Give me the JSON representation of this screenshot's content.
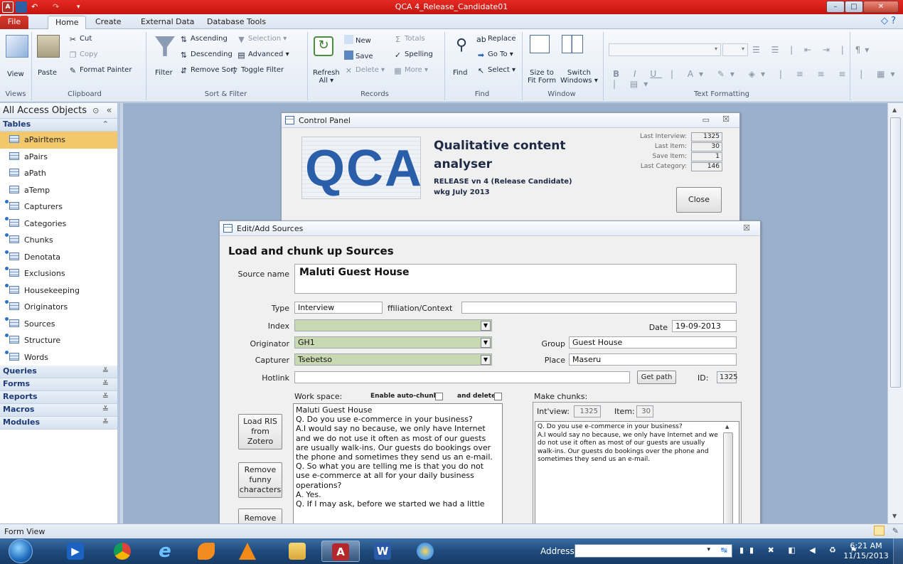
{
  "app": {
    "title": "QCA 4_Release_Candidate01",
    "window_buttons": [
      "–",
      "□",
      "✕"
    ]
  },
  "tabs": [
    "File",
    "Home",
    "Create",
    "External Data",
    "Database Tools"
  ],
  "ribbon": {
    "views": {
      "view": "View",
      "label": "Views"
    },
    "clipboard": {
      "paste": "Paste",
      "cut": "Cut",
      "copy": "Copy",
      "format_painter": "Format Painter",
      "label": "Clipboard"
    },
    "sort_filter": {
      "filter": "Filter",
      "ascending": "Ascending",
      "descending": "Descending",
      "remove_sort": "Remove Sort",
      "selection": "Selection",
      "advanced": "Advanced",
      "toggle_filter": "Toggle Filter",
      "label": "Sort & Filter"
    },
    "records": {
      "refresh": "Refresh",
      "refresh_sub": "All",
      "new": "New",
      "save": "Save",
      "delete": "Delete",
      "totals": "Totals",
      "spelling": "Spelling",
      "more": "More",
      "label": "Records"
    },
    "find": {
      "find": "Find",
      "replace": "Replace",
      "goto": "Go To",
      "select": "Select",
      "label": "Find"
    },
    "window": {
      "size_to_fit": "Size to",
      "size_to_fit2": "Fit Form",
      "switch": "Switch",
      "switch2": "Windows",
      "label": "Window"
    },
    "text_formatting": {
      "label": "Text Formatting"
    }
  },
  "nav": {
    "header": "All Access Objects",
    "tables_label": "Tables",
    "tables": [
      {
        "name": "aPairItems",
        "linked": false
      },
      {
        "name": "aPairs",
        "linked": false
      },
      {
        "name": "aPath",
        "linked": false
      },
      {
        "name": "aTemp",
        "linked": false
      },
      {
        "name": "Capturers",
        "linked": true
      },
      {
        "name": "Categories",
        "linked": true
      },
      {
        "name": "Chunks",
        "linked": true
      },
      {
        "name": "Denotata",
        "linked": true
      },
      {
        "name": "Exclusions",
        "linked": true
      },
      {
        "name": "Housekeeping",
        "linked": true
      },
      {
        "name": "Originators",
        "linked": true
      },
      {
        "name": "Sources",
        "linked": true
      },
      {
        "name": "Structure",
        "linked": true
      },
      {
        "name": "Words",
        "linked": true
      }
    ],
    "groups": [
      "Queries",
      "Forms",
      "Reports",
      "Macros",
      "Modules"
    ]
  },
  "control_panel": {
    "title": "Control Panel",
    "logo_text": "QCA",
    "heading_line1": "Qualitative content",
    "heading_line2": "analyser",
    "release": "RELEASE vn 4 (Release Candidate)",
    "date": "wkg July 2013",
    "stats": [
      {
        "label": "Last Interview:",
        "value": "1325"
      },
      {
        "label": "Last Item:",
        "value": "30"
      },
      {
        "label": "Save Item:",
        "value": "1"
      },
      {
        "label": "Last Category:",
        "value": "146"
      }
    ],
    "close_button": "Close"
  },
  "sources_form": {
    "title": "Edit/Add Sources",
    "heading": "Load and chunk up Sources",
    "source_name_label": "Source name",
    "source_name": "Maluti Guest House",
    "type_label": "Type",
    "type": "Interview",
    "affiliation_label": "ffiliation/Context",
    "affiliation": "",
    "date_label": "Date",
    "date": "19-09-2013",
    "index_label": "Index",
    "index": "",
    "originator_label": "Originator",
    "originator": "GH1",
    "group_label": "Group",
    "group": "Guest House",
    "capturer_label": "Capturer",
    "capturer": "Tsebetso",
    "place_label": "Place",
    "place": "Maseru",
    "hotlink_label": "Hotlink",
    "hotlink": "",
    "get_path": "Get path",
    "id_label": "ID:",
    "id": "1325",
    "workspace_label": "Work space:",
    "auto_chunk_label": "Enable auto-chunk:",
    "and_delete_label": "and delete:",
    "make_chunks_label": "Make chunks:",
    "intview_label": "Int'view:",
    "intview": "1325",
    "item_label": "Item:",
    "item": "30",
    "buttons": [
      "Load RIS\nfrom\nZotero",
      "Remove\nfunny\ncharacters",
      "Remove"
    ],
    "workspace_text": "Maluti Guest House\nQ. Do you use e-commerce in your business?\nA.I would say no because, we only have Internet and we do not use it often as most of our guests are usually walk-ins. Our guests do bookings over the phone and sometimes they send us an e-mail.\nQ. So what you are telling me is that you do not use e-commerce at all for your daily business operations?\nA. Yes.\nQ. If I may ask, before we started we had a little",
    "chunk_text": "Q. Do you use e-commerce in your business?\nA.I would say no because, we only have Internet and we do not use it often as most of our guests are usually walk-ins. Our guests do bookings over the phone and sometimes they send us an e-mail."
  },
  "status": {
    "text": "Form View"
  },
  "taskbar": {
    "address_label": "Address",
    "time": "6:21 AM",
    "date": "11/15/2013"
  },
  "colors": {
    "title_red": "#d11f17",
    "accent_blue": "#1e3a7a",
    "field_green": "#c8d9b2"
  }
}
